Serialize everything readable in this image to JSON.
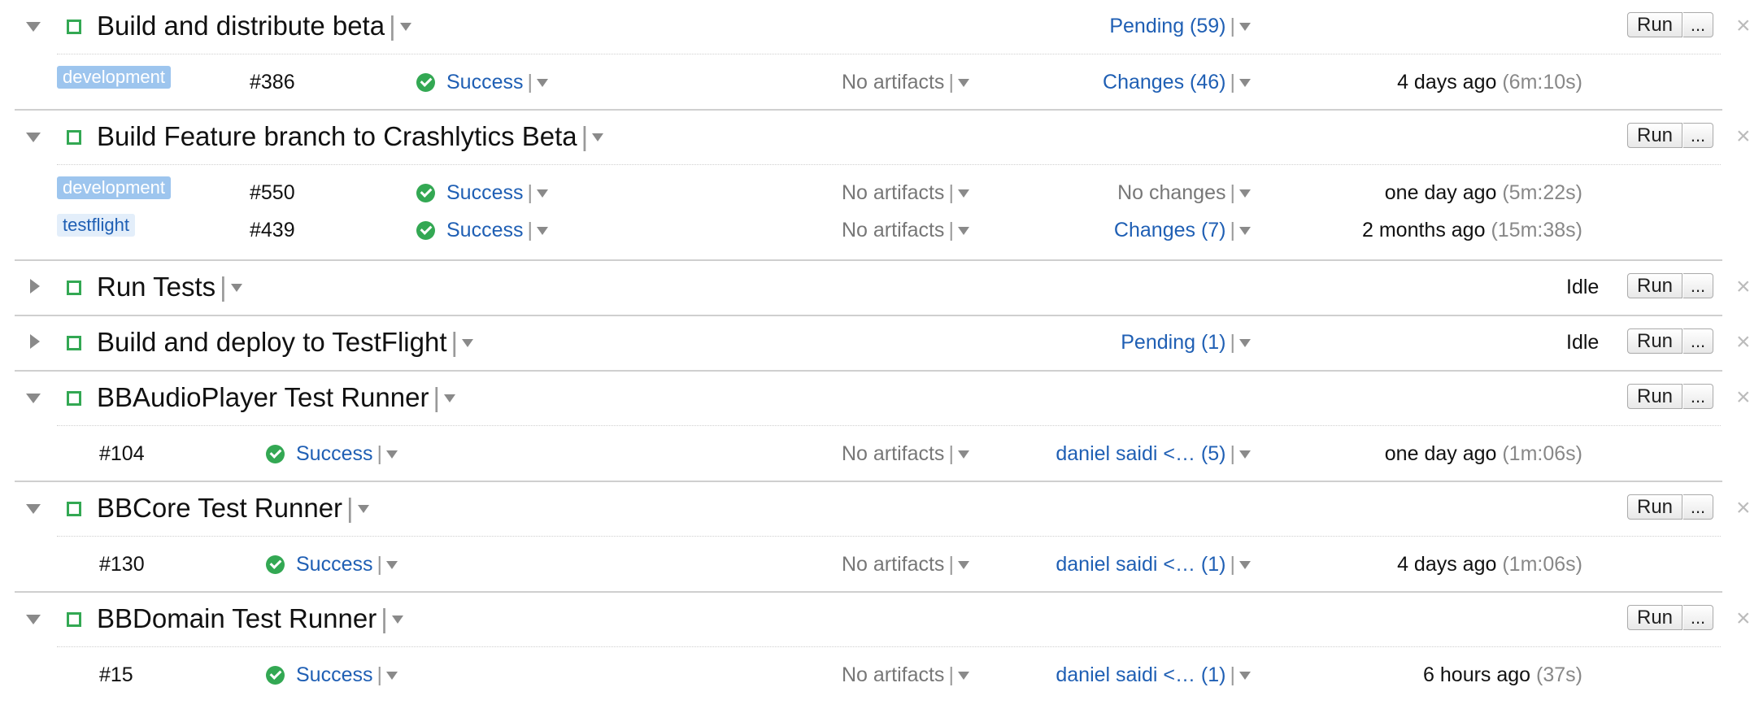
{
  "common": {
    "run_label": "Run",
    "more_label": "...",
    "close_label": "×",
    "pipe": "|",
    "no_artifacts": "No artifacts"
  },
  "configs": [
    {
      "name": "Build and distribute beta",
      "expanded": true,
      "pending": "Pending (59)",
      "status": "",
      "builds": [
        {
          "branch": "development",
          "number": "#386",
          "status": "Success",
          "changes": "Changes (46)",
          "time": "4 days ago",
          "duration": "(6m:10s)"
        }
      ]
    },
    {
      "name": "Build Feature branch to Crashlytics Beta",
      "expanded": true,
      "pending": "",
      "status": "",
      "builds": [
        {
          "branch": "development",
          "number": "#550",
          "status": "Success",
          "changes": "No changes",
          "time": "one day ago",
          "duration": "(5m:22s)"
        },
        {
          "branch": "testflight",
          "number": "#439",
          "status": "Success",
          "changes": "Changes (7)",
          "time": "2 months ago",
          "duration": "(15m:38s)"
        }
      ]
    },
    {
      "name": "Run Tests",
      "expanded": false,
      "pending": "",
      "status": "Idle",
      "builds": []
    },
    {
      "name": "Build and deploy to TestFlight",
      "expanded": false,
      "pending": "Pending (1)",
      "status": "Idle",
      "builds": []
    },
    {
      "name": "BBAudioPlayer Test Runner",
      "expanded": true,
      "pending": "",
      "status": "",
      "builds": [
        {
          "branch": "",
          "number": "#104",
          "status": "Success",
          "changes": "daniel saidi <… (5)",
          "time": "one day ago",
          "duration": "(1m:06s)"
        }
      ]
    },
    {
      "name": "BBCore Test Runner",
      "expanded": true,
      "pending": "",
      "status": "",
      "builds": [
        {
          "branch": "",
          "number": "#130",
          "status": "Success",
          "changes": "daniel saidi <… (1)",
          "time": "4 days ago",
          "duration": "(1m:06s)"
        }
      ]
    },
    {
      "name": "BBDomain Test Runner",
      "expanded": true,
      "pending": "",
      "status": "",
      "builds": [
        {
          "branch": "",
          "number": "#15",
          "status": "Success",
          "changes": "daniel saidi <… (1)",
          "time": "6 hours ago",
          "duration": "(37s)"
        }
      ]
    }
  ]
}
